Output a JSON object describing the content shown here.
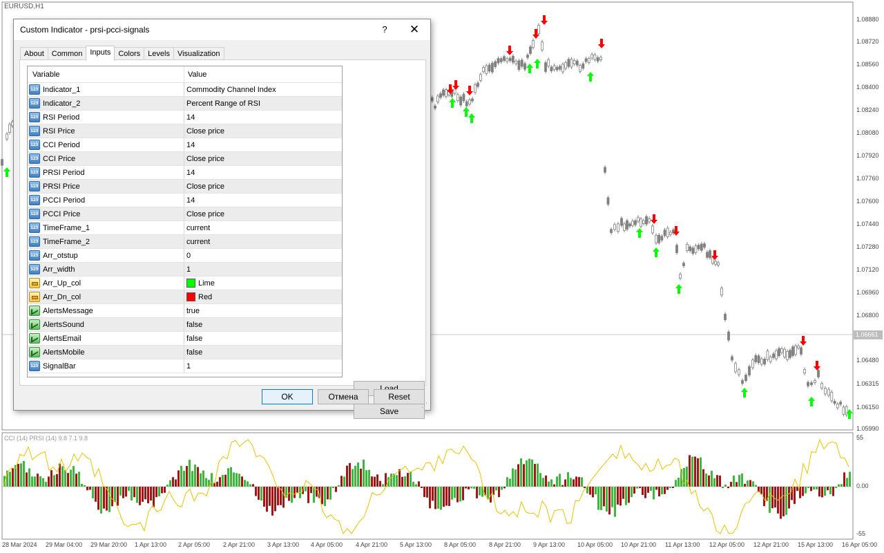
{
  "chart": {
    "symbol_title": "EURUSD,H1",
    "indicator_label": "CCI (14) PRSI (14) 9.8 7.1 9.8",
    "current_price": "1.06661",
    "price_axis": [
      "1.08880",
      "1.08720",
      "1.08560",
      "1.08400",
      "1.08240",
      "1.08080",
      "1.07920",
      "1.07760",
      "1.07600",
      "1.07440",
      "1.07280",
      "1.07120",
      "1.06960",
      "1.06800",
      "1.06480",
      "1.06315",
      "1.06150",
      "1.05990"
    ],
    "sub_axis": [
      "55",
      "0.00",
      "-55"
    ],
    "time_axis": [
      "28 Mar 2024",
      "29 Mar 04:00",
      "29 Mar 20:00",
      "1 Apr 13:00",
      "2 Apr 05:00",
      "2 Apr 21:00",
      "3 Apr 13:00",
      "4 Apr 05:00",
      "4 Apr 21:00",
      "5 Apr 13:00",
      "8 Apr 05:00",
      "8 Apr 21:00",
      "9 Apr 13:00",
      "10 Apr 05:00",
      "10 Apr 21:00",
      "11 Apr 13:00",
      "12 Apr 05:00",
      "12 Apr 21:00",
      "15 Apr 13:00",
      "16 Apr 05:00"
    ],
    "colors": {
      "up_arrow": "#00ff00",
      "down_arrow": "#ff0000",
      "bull_hist": "#3cb83c",
      "bear_hist": "#a31515",
      "line": "#e6c400",
      "candle": "#808080"
    },
    "chart_data": {
      "type": "line",
      "title": "",
      "series": [
        {
          "x": [
            "28 Mar 2024",
            "29 Mar 04:00",
            "29 Mar 20:00",
            "1 Apr 13:00",
            "2 Apr 05:00",
            "2 Apr 21:00",
            "3 Apr 13:00",
            "4 Apr 05:00",
            "4 Apr 21:00",
            "5 Apr 13:00",
            "8 Apr 05:00",
            "8 Apr 21:00",
            "9 Apr 13:00",
            "10 Apr 05:00",
            "10 Apr 21:00",
            "11 Apr 13:00",
            "12 Apr 05:00",
            "12 Apr 21:00",
            "15 Apr 13:00",
            "16 Apr 05:00"
          ],
          "values": [
            1.079,
            1.0785,
            1.0792,
            1.08,
            1.081,
            1.0825,
            1.083,
            1.0835,
            1.084,
            1.0835,
            1.083,
            1.086,
            1.0865,
            1.0855,
            1.074,
            1.073,
            1.069,
            1.063,
            1.064,
            1.0615
          ]
        }
      ],
      "ylim": [
        1.0599,
        1.0888
      ]
    }
  },
  "dialog": {
    "title": "Custom Indicator - prsi-pcci-signals",
    "help": "?",
    "close": "✕",
    "tabs": [
      "About",
      "Common",
      "Inputs",
      "Colors",
      "Levels",
      "Visualization"
    ],
    "active_tab": "Inputs",
    "grid": {
      "headers": {
        "variable": "Variable",
        "value": "Value"
      },
      "rows": [
        {
          "variable": "Indicator_1",
          "value": "Commodity Channel Index",
          "type": "num"
        },
        {
          "variable": "Indicator_2",
          "value": "Percent Range of RSI",
          "type": "num"
        },
        {
          "variable": "RSI Period",
          "value": "14",
          "type": "num"
        },
        {
          "variable": "RSI Price",
          "value": "Close price",
          "type": "num"
        },
        {
          "variable": "CCI Period",
          "value": "14",
          "type": "num"
        },
        {
          "variable": "CCI Price",
          "value": "Close price",
          "type": "num"
        },
        {
          "variable": "PRSI Period",
          "value": "14",
          "type": "num"
        },
        {
          "variable": "PRSI Price",
          "value": "Close price",
          "type": "num"
        },
        {
          "variable": "PCCI Period",
          "value": "14",
          "type": "num"
        },
        {
          "variable": "PCCI Price",
          "value": "Close price",
          "type": "num"
        },
        {
          "variable": "TimeFrame_1",
          "value": "current",
          "type": "num"
        },
        {
          "variable": "TimeFrame_2",
          "value": "current",
          "type": "num"
        },
        {
          "variable": "Arr_otstup",
          "value": "0",
          "type": "num"
        },
        {
          "variable": "Arr_width",
          "value": "1",
          "type": "num"
        },
        {
          "variable": "Arr_Up_col",
          "value": "Lime",
          "type": "color",
          "swatch": "#00ff00"
        },
        {
          "variable": "Arr_Dn_col",
          "value": "Red",
          "type": "color",
          "swatch": "#ff0000"
        },
        {
          "variable": "AlertsMessage",
          "value": "true",
          "type": "bool"
        },
        {
          "variable": "AlertsSound",
          "value": "false",
          "type": "bool"
        },
        {
          "variable": "AlertsEmail",
          "value": "false",
          "type": "bool"
        },
        {
          "variable": "AlertsMobile",
          "value": "false",
          "type": "bool"
        },
        {
          "variable": "SignalBar",
          "value": "1",
          "type": "num"
        }
      ]
    },
    "buttons": {
      "load": "Load",
      "save": "Save",
      "ok": "OK",
      "cancel": "Отмена",
      "reset": "Reset"
    }
  }
}
